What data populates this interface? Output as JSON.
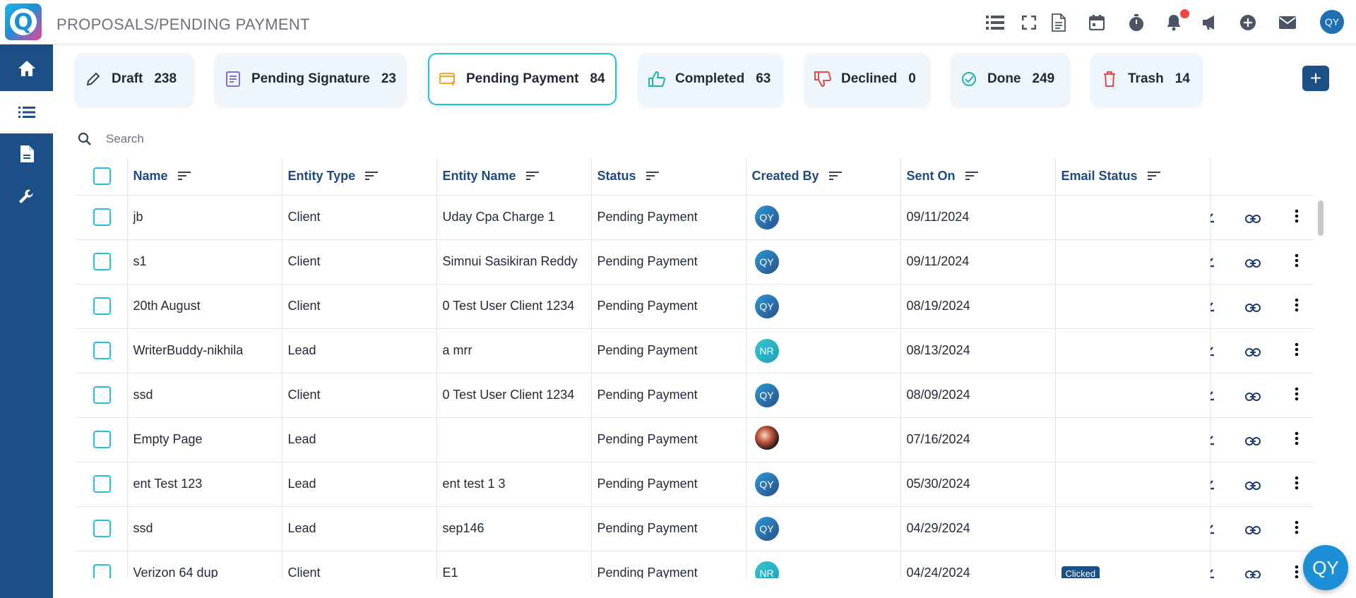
{
  "header": {
    "breadcrumb": "PROPOSALS/PENDING PAYMENT",
    "logo_letter": "Q",
    "user_initials": "QY"
  },
  "tabs": [
    {
      "label": "Draft",
      "count": "238"
    },
    {
      "label": "Pending Signature",
      "count": "23"
    },
    {
      "label": "Pending Payment",
      "count": "84"
    },
    {
      "label": "Completed",
      "count": "63"
    },
    {
      "label": "Declined",
      "count": "0"
    },
    {
      "label": "Done",
      "count": "249"
    },
    {
      "label": "Trash",
      "count": "14"
    }
  ],
  "add_button_label": "+",
  "search": {
    "placeholder": "Search"
  },
  "table": {
    "columns": [
      "Name",
      "Entity Type",
      "Entity Name",
      "Status",
      "Created By",
      "Sent On",
      "Email Status"
    ],
    "rows": [
      {
        "name": "jb",
        "entity_type": "Client",
        "entity_name": "Uday Cpa Charge 1",
        "status": "Pending Payment",
        "created_by": "QY",
        "sent_on": "09/11/2024",
        "email_status": ""
      },
      {
        "name": "s1",
        "entity_type": "Client",
        "entity_name": "Simnui Sasikiran Reddy",
        "status": "Pending Payment",
        "created_by": "QY",
        "sent_on": "09/11/2024",
        "email_status": ""
      },
      {
        "name": "20th August",
        "entity_type": "Client",
        "entity_name": "0 Test User Client 1234",
        "status": "Pending Payment",
        "created_by": "QY",
        "sent_on": "08/19/2024",
        "email_status": ""
      },
      {
        "name": "WriterBuddy-nikhila",
        "entity_type": "Lead",
        "entity_name": "a mrr",
        "status": "Pending Payment",
        "created_by": "NR",
        "sent_on": "08/13/2024",
        "email_status": ""
      },
      {
        "name": "ssd",
        "entity_type": "Client",
        "entity_name": "0 Test User Client 1234",
        "status": "Pending Payment",
        "created_by": "QY",
        "sent_on": "08/09/2024",
        "email_status": ""
      },
      {
        "name": "Empty Page",
        "entity_type": "Lead",
        "entity_name": "",
        "status": "Pending Payment",
        "created_by": "",
        "sent_on": "07/16/2024",
        "email_status": ""
      },
      {
        "name": "ent Test 123",
        "entity_type": "Lead",
        "entity_name": "ent test 1 3",
        "status": "Pending Payment",
        "created_by": "QY",
        "sent_on": "05/30/2024",
        "email_status": ""
      },
      {
        "name": "ssd",
        "entity_type": "Lead",
        "entity_name": "sep146",
        "status": "Pending Payment",
        "created_by": "QY",
        "sent_on": "04/29/2024",
        "email_status": ""
      },
      {
        "name": "Verizon 64 dup",
        "entity_type": "Client",
        "entity_name": "E1",
        "status": "Pending Payment",
        "created_by": "NR",
        "sent_on": "04/24/2024",
        "email_status": "Clicked"
      }
    ]
  },
  "chat_fab_label": "QY",
  "colors": {
    "sidebar": "#1b4f85",
    "accent": "#22c1dc",
    "header_text": "#1e4a80"
  }
}
